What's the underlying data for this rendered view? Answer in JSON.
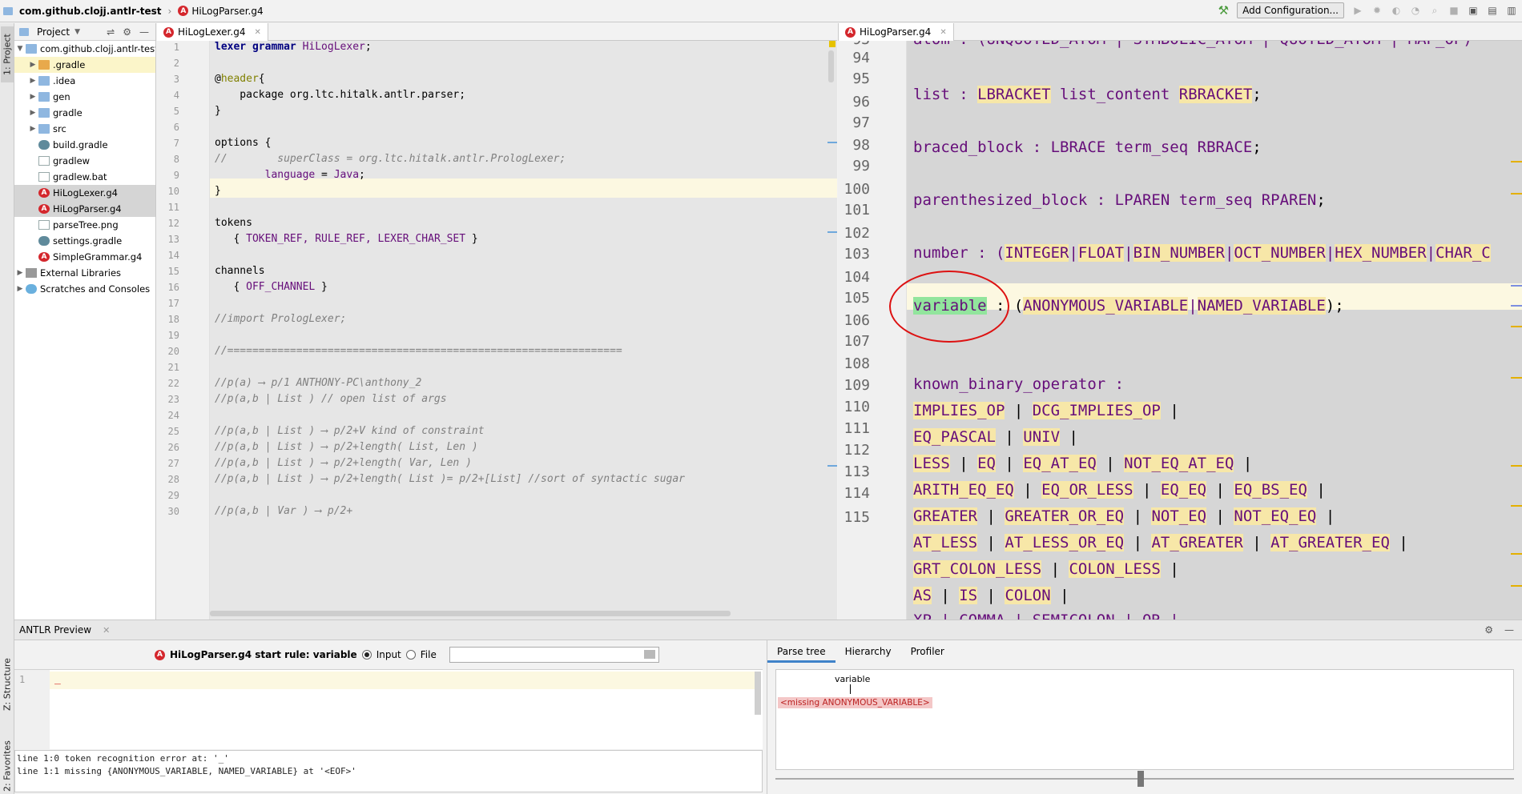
{
  "navbar": {
    "project": "com.github.clojj.antlr-test",
    "file": "HiLogParser.g4",
    "add_configuration": "Add Configuration..."
  },
  "stripe": {
    "project_tab": "1: Project",
    "structure_tab": "Z: Structure",
    "favorites_tab": "2: Favorites"
  },
  "project_panel": {
    "title": "Project",
    "items": [
      {
        "label": "com.github.clojj.antlr-test",
        "kind": "folder"
      },
      {
        "label": ".gradle",
        "kind": "folder-orange"
      },
      {
        "label": ".idea",
        "kind": "folder"
      },
      {
        "label": "gen",
        "kind": "folder"
      },
      {
        "label": "gradle",
        "kind": "folder"
      },
      {
        "label": "src",
        "kind": "folder"
      },
      {
        "label": "build.gradle",
        "kind": "gradle"
      },
      {
        "label": "gradlew",
        "kind": "file"
      },
      {
        "label": "gradlew.bat",
        "kind": "file"
      },
      {
        "label": "HiLogLexer.g4",
        "kind": "antlr"
      },
      {
        "label": "HiLogParser.g4",
        "kind": "antlr"
      },
      {
        "label": "parseTree.png",
        "kind": "file"
      },
      {
        "label": "settings.gradle",
        "kind": "gradle"
      },
      {
        "label": "SimpleGrammar.g4",
        "kind": "antlr"
      },
      {
        "label": "External Libraries",
        "kind": "lib"
      },
      {
        "label": "Scratches and Consoles",
        "kind": "lib"
      }
    ]
  },
  "editor_left": {
    "tab": "HiLogLexer.g4",
    "lines": [
      "1",
      "2",
      "3",
      "4",
      "5",
      "6",
      "7",
      "8",
      "9",
      "10",
      "11",
      "12",
      "13",
      "14",
      "15",
      "16",
      "17",
      "18",
      "19",
      "20",
      "21",
      "22",
      "23",
      "24",
      "25",
      "26",
      "27",
      "28",
      "29",
      "30"
    ],
    "code": {
      "l1_kw": "lexer grammar",
      "l1_name": " HiLogLexer",
      "l1_end": ";",
      "l3_at": "@",
      "l3_name": "header",
      "l3_end": "{",
      "l4": "    package org.ltc.hitalk.antlr.parser;",
      "l5": "}",
      "l7": "options {",
      "l8": "//        superClass = org.ltc.hitalk.antlr.PrologLexer;",
      "l9_a": "        language",
      "l9_b": " = ",
      "l9_c": "Java",
      "l9_d": ";",
      "l10": "}",
      "l12": "tokens",
      "l13_a": "   { ",
      "l13_b": "TOKEN_REF, RULE_REF, LEXER_CHAR_SET",
      "l13_c": " }",
      "l15": "channels",
      "l16_a": "   { ",
      "l16_b": "OFF_CHANNEL",
      "l16_c": " }",
      "l18": "//import PrologLexer;",
      "l20": "//===============================================================",
      "l22": "//p(a) ⟶ p/1 ANTHONY-PC\\anthony_2",
      "l23": "//p(a,b | List ) // open list of args",
      "l25": "//p(a,b | List ) ⟶ p/2+V kind of constraint",
      "l26": "//p(a,b | List ) ⟶ p/2+length( List, Len )",
      "l27": "//p(a,b | List ) ⟶ p/2+length( Var, Len )",
      "l28": "//p(a,b | List ) ⟶ p/2+length( List )= p/2+[List] //sort of syntactic sugar",
      "l30": "//p(a,b | Var ) ⟶ p/2+"
    }
  },
  "editor_right": {
    "tab": "HiLogParser.g4",
    "lines": [
      "93",
      "94",
      "95",
      "96",
      "97",
      "98",
      "99",
      "100",
      "101",
      "102",
      "103",
      "104",
      "105",
      "106",
      "107",
      "108",
      "109",
      "110",
      "111",
      "112",
      "113",
      "114",
      "115"
    ],
    "code": {
      "l93": "atom : (UNQUOTED_ATOM | SYMBOLIC_ATOM | QUOTED_ATOM | MAP_OP)",
      "l95_a": "list : ",
      "l95_b": "LBRACKET",
      "l95_c": " list_content ",
      "l95_d": "RBRACKET",
      "l95_e": ";",
      "l97_a": "braced_block : ",
      "l97_b": "LBRACE",
      "l97_c": " term_seq ",
      "l97_d": "RBRACE",
      "l97_e": ";",
      "l99_a": "parenthesized_block : ",
      "l99_b": "LPAREN",
      "l99_c": " term_seq ",
      "l99_d": "RPAREN",
      "l99_e": ";",
      "l101_a": "number : (",
      "l101_t1": "INTEGER",
      "l101_t2": "FLOAT",
      "l101_t3": "BIN_NUMBER",
      "l101_t4": "OCT_NUMBER",
      "l101_t5": "HEX_NUMBER",
      "l101_t6": "CHAR_C",
      "l103_var": "variable",
      "l103_b": " : (",
      "l103_t1": "ANONYMOUS_VARIABLE",
      "l103_t2": "NAMED_VARIABLE",
      "l103_e": ");",
      "l106": "known_binary_operator :",
      "l107_t1": "IMPLIES_OP",
      "l107_t2": "DCG_IMPLIES_OP",
      "l108_t1": "EQ_PASCAL",
      "l108_t2": "UNIV",
      "l109_t1": "LESS",
      "l109_t2": "EQ",
      "l109_t3": "EQ_AT_EQ",
      "l109_t4": "NOT_EQ_AT_EQ",
      "l110_t1": "ARITH_EQ_EQ",
      "l110_t2": "EQ_OR_LESS",
      "l110_t3": "EQ_EQ",
      "l110_t4": "EQ_BS_EQ",
      "l111_t1": "GREATER",
      "l111_t2": "GREATER_OR_EQ",
      "l111_t3": "NOT_EQ",
      "l111_t4": "NOT_EQ_EQ",
      "l112_t1": "AT_LESS",
      "l112_t2": "AT_LESS_OR_EQ",
      "l112_t3": "AT_GREATER",
      "l112_t4": "AT_GREATER_EQ",
      "l113_t1": "GRT_COLON_LESS",
      "l113_t2": "COLON_LESS",
      "l114_t1": "AS",
      "l114_t2": "IS",
      "l114_t3": "COLON",
      "l115": "XP | COMMA | SEMICOLON | OR |",
      "bar": " | ",
      "pipe": "|"
    }
  },
  "antlr_preview": {
    "title": "ANTLR Preview",
    "start_rule": "HiLogParser.g4 start rule: variable",
    "input_label": "Input",
    "file_label": "File",
    "input_line_no": "1",
    "input_text": "_",
    "console": [
      "line 1:0 token recognition error at: '_'",
      "line 1:1 missing {ANONYMOUS_VARIABLE, NAMED_VARIABLE} at '<EOF>'"
    ],
    "tabs": [
      "Parse tree",
      "Hierarchy",
      "Profiler"
    ],
    "tree_root": "variable",
    "tree_missing": "<missing ANONYMOUS_VARIABLE>"
  }
}
